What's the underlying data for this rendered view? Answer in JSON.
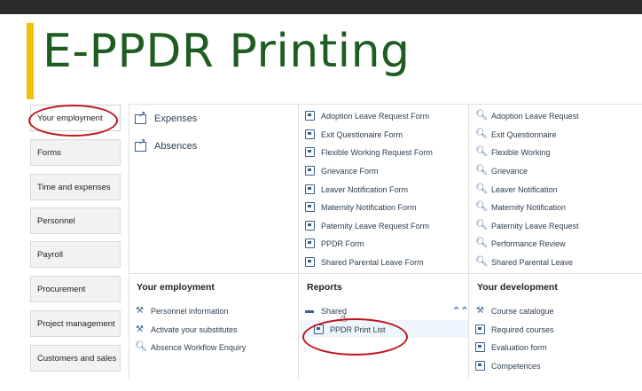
{
  "title": "E-PPDR Printing",
  "sidebar": {
    "items": [
      {
        "label": "Your employment"
      },
      {
        "label": "Forms"
      },
      {
        "label": "Time and expenses"
      },
      {
        "label": "Personnel"
      },
      {
        "label": "Payroll"
      },
      {
        "label": "Procurement"
      },
      {
        "label": "Project management"
      },
      {
        "label": "Customers and sales"
      }
    ]
  },
  "quick_links": [
    {
      "label": "Expenses"
    },
    {
      "label": "Absences"
    }
  ],
  "forms": [
    "Adoption Leave Request Form",
    "Exit Questionaire Form",
    "Flexible Working Request Form",
    "Grievance Form",
    "Leaver Notification Form",
    "Maternity Notification Form",
    "Paternity Leave Request Form",
    "PPDR Form",
    "Shared Parental Leave Form"
  ],
  "enquiries": [
    "Adoption Leave Request",
    "Exit Questionnaire",
    "Flexible Working",
    "Grievance",
    "Leaver Notification",
    "Maternity Notification",
    "Paternity Leave Request",
    "Performance Review",
    "Shared Parental Leave"
  ],
  "your_employment": {
    "heading": "Your employment",
    "items": [
      "Personnel information",
      "Activate your substitutes",
      "Absence Workflow Enquiry"
    ]
  },
  "reports": {
    "heading": "Reports",
    "items": [
      "Shared",
      "PPDR Print List"
    ]
  },
  "your_development": {
    "heading": "Your development",
    "items": [
      "Course catalogue",
      "Required courses",
      "Evaluation form",
      "Competences"
    ]
  },
  "colors": {
    "title_green": "#1f5c22",
    "accent_yellow": "#f2c100",
    "icon_blue": "#3a5f8c",
    "annotation_red": "#c0131b"
  }
}
